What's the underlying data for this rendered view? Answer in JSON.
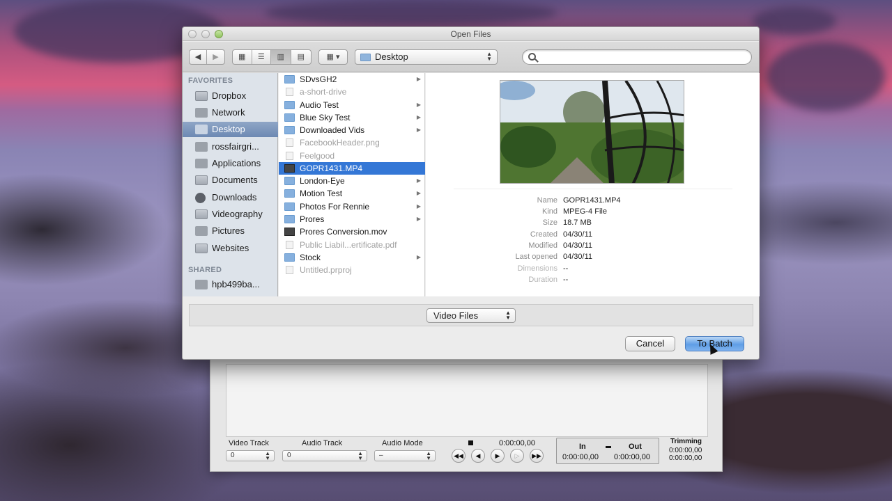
{
  "dialog": {
    "title": "Open Files",
    "path": "Desktop",
    "search_placeholder": "",
    "view_icons": [
      "icon-view-icon",
      "list-view-icon",
      "column-view-icon",
      "coverflow-view-icon"
    ],
    "nav_icons": [
      "back-arrow-icon",
      "forward-arrow-icon"
    ]
  },
  "sidebar": {
    "favorites_header": "FAVORITES",
    "favorites": [
      {
        "label": "Dropbox",
        "icon": "folder-icon"
      },
      {
        "label": "Network",
        "icon": "network-icon"
      },
      {
        "label": "Desktop",
        "icon": "desktop-icon",
        "selected": true
      },
      {
        "label": "rossfairgri...",
        "icon": "home-icon"
      },
      {
        "label": "Applications",
        "icon": "applications-icon"
      },
      {
        "label": "Documents",
        "icon": "documents-icon"
      },
      {
        "label": "Downloads",
        "icon": "downloads-icon"
      },
      {
        "label": "Videography",
        "icon": "folder-icon"
      },
      {
        "label": "Pictures",
        "icon": "pictures-icon"
      },
      {
        "label": "Websites",
        "icon": "folder-icon"
      }
    ],
    "shared_header": "SHARED",
    "shared": [
      {
        "label": "hpb499ba...",
        "icon": "computer-icon"
      }
    ]
  },
  "files": [
    {
      "name": "SDvsGH2",
      "kind": "folder",
      "dim": false,
      "has_children": true
    },
    {
      "name": "a-short-drive",
      "kind": "doc",
      "dim": true,
      "has_children": false
    },
    {
      "name": "Audio Test",
      "kind": "folder",
      "dim": false,
      "has_children": true
    },
    {
      "name": "Blue Sky Test",
      "kind": "folder",
      "dim": false,
      "has_children": true
    },
    {
      "name": "Downloaded Vids",
      "kind": "folder",
      "dim": false,
      "has_children": true
    },
    {
      "name": "FacebookHeader.png",
      "kind": "doc",
      "dim": true,
      "has_children": false
    },
    {
      "name": "Feelgood",
      "kind": "doc",
      "dim": true,
      "has_children": false
    },
    {
      "name": "GOPR1431.MP4",
      "kind": "movie",
      "dim": false,
      "has_children": false,
      "selected": true
    },
    {
      "name": "London-Eye",
      "kind": "folder",
      "dim": false,
      "has_children": true
    },
    {
      "name": "Motion Test",
      "kind": "folder",
      "dim": false,
      "has_children": true
    },
    {
      "name": "Photos For Rennie",
      "kind": "folder",
      "dim": false,
      "has_children": true
    },
    {
      "name": "Prores",
      "kind": "folder",
      "dim": false,
      "has_children": true
    },
    {
      "name": "Prores Conversion.mov",
      "kind": "movie",
      "dim": false,
      "has_children": false
    },
    {
      "name": "Public Liabil...ertificate.pdf",
      "kind": "doc",
      "dim": true,
      "has_children": false
    },
    {
      "name": "Stock",
      "kind": "folder",
      "dim": false,
      "has_children": true
    },
    {
      "name": "Untitled.prproj",
      "kind": "doc",
      "dim": true,
      "has_children": false
    }
  ],
  "preview": {
    "meta": [
      {
        "key": "Name",
        "value": "GOPR1431.MP4"
      },
      {
        "key": "Kind",
        "value": "MPEG-4 File"
      },
      {
        "key": "Size",
        "value": "18.7 MB"
      },
      {
        "key": "Created",
        "value": "04/30/11"
      },
      {
        "key": "Modified",
        "value": "04/30/11"
      },
      {
        "key": "Last opened",
        "value": "04/30/11"
      },
      {
        "key": "Dimensions",
        "value": "--"
      },
      {
        "key": "Duration",
        "value": "--"
      }
    ]
  },
  "filter": {
    "selected": "Video Files"
  },
  "buttons": {
    "cancel": "Cancel",
    "confirm": "To Batch"
  },
  "background_app": {
    "video_track_label": "Video Track",
    "video_track_value": "0",
    "audio_track_label": "Audio Track",
    "audio_track_value": "0",
    "audio_mode_label": "Audio Mode",
    "audio_mode_value": "–",
    "current_time": "0:00:00,00",
    "in_label": "In",
    "out_label": "Out",
    "in_time": "0:00:00,00",
    "out_time": "0:00:00,00",
    "trimming_label": "Trimming",
    "trimming_values": [
      "0:00:00,00",
      "0:00:00,00"
    ]
  }
}
